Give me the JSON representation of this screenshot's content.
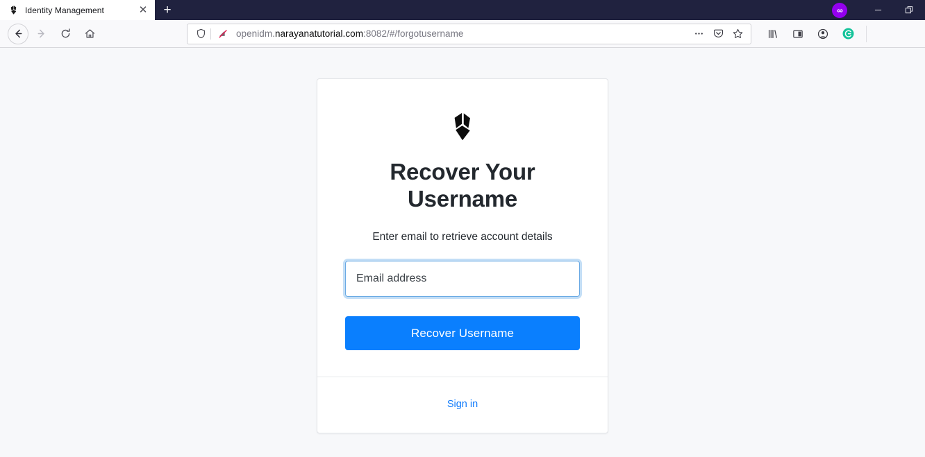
{
  "browser": {
    "tab": {
      "title": "Identity Management",
      "favicon_icon": "forgerock-logo-icon",
      "close_icon": "close-icon",
      "close_glyph": "✕"
    },
    "new_tab": {
      "label": "+",
      "icon": "plus-icon"
    },
    "window_controls": {
      "container_badge_icon": "container-mask-icon",
      "container_badge_glyph": "∞",
      "minimize_icon": "minimize-icon",
      "restore_icon": "restore-window-icon"
    },
    "nav": {
      "back_icon": "back-arrow-icon",
      "forward_icon": "forward-arrow-icon",
      "reload_icon": "reload-icon",
      "home_icon": "home-icon"
    },
    "urlbar": {
      "shield_icon": "tracking-protection-shield-icon",
      "permission_icon": "permission-blocked-icon",
      "url_host_prefix": "openidm.",
      "url_host_bold": "narayanatutorial.com",
      "url_path": ":8082/#/forgotusername",
      "full_url": "openidm.narayanatutorial.com:8082/#/forgotusername",
      "page_actions_icon": "ellipsis-icon",
      "pocket_icon": "pocket-icon",
      "bookmark_icon": "star-icon"
    },
    "toolbar_right": {
      "library_icon": "library-icon",
      "sidebar_icon": "sidebar-icon",
      "account_icon": "account-avatar-icon",
      "grammarly_icon": "grammarly-icon",
      "grammarly_letter": "G"
    }
  },
  "page": {
    "logo_icon": "forgerock-logo-icon",
    "title": "Recover Your Username",
    "subtitle": "Enter email to retrieve account details",
    "email_field": {
      "value": "",
      "placeholder": "Email address"
    },
    "submit_label": "Recover Username",
    "footer_link": "Sign in",
    "colors": {
      "accent_blue": "#0a7ffe",
      "link_blue": "#107bfb",
      "heading": "#23282e",
      "page_background": "#f7f8fa",
      "card_background": "#ffffff",
      "focus_ring": "#7ab5eb"
    }
  }
}
